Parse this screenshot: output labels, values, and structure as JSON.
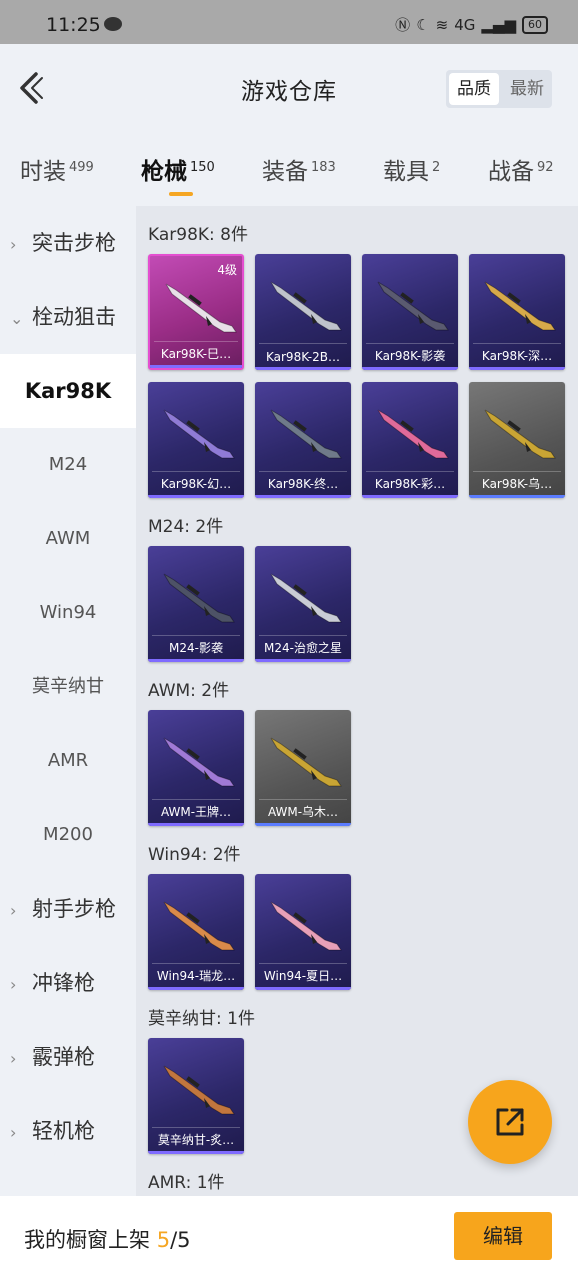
{
  "status_bar": {
    "time": "11:25",
    "network": "4G",
    "battery": "60"
  },
  "header": {
    "title": "游戏仓库",
    "sort_options": [
      "品质",
      "最新"
    ],
    "sort_active": "品质"
  },
  "category_tabs": [
    {
      "label": "时装",
      "count": "499"
    },
    {
      "label": "枪械",
      "count": "150",
      "active": true
    },
    {
      "label": "装备",
      "count": "183"
    },
    {
      "label": "载具",
      "count": "2"
    },
    {
      "label": "战备",
      "count": "92"
    }
  ],
  "sidebar": [
    {
      "label": "突击步枪",
      "type": "group",
      "expanded": false
    },
    {
      "label": "栓动狙击",
      "type": "group",
      "expanded": true
    },
    {
      "label": "Kar98K",
      "type": "sub",
      "selected": true
    },
    {
      "label": "M24",
      "type": "sub"
    },
    {
      "label": "AWM",
      "type": "sub"
    },
    {
      "label": "Win94",
      "type": "sub"
    },
    {
      "label": "莫辛纳甘",
      "type": "sub"
    },
    {
      "label": "AMR",
      "type": "sub"
    },
    {
      "label": "M200",
      "type": "sub"
    },
    {
      "label": "射手步枪",
      "type": "group",
      "expanded": false
    },
    {
      "label": "冲锋枪",
      "type": "group",
      "expanded": false
    },
    {
      "label": "霰弹枪",
      "type": "group",
      "expanded": false
    },
    {
      "label": "轻机枪",
      "type": "group",
      "expanded": false
    }
  ],
  "sections": [
    {
      "title": "Kar98K: 8件",
      "items": [
        {
          "name": "Kar98K-巳…",
          "style": "pink",
          "level": "4级",
          "gun_color": "#e8e0e8"
        },
        {
          "name": "Kar98K-2B…",
          "style": "purple",
          "gun_color": "#bfc3cc"
        },
        {
          "name": "Kar98K-影袭",
          "style": "purple",
          "gun_color": "#5a5a70"
        },
        {
          "name": "Kar98K-深…",
          "style": "purple",
          "gun_color": "#d6a94a"
        },
        {
          "name": "Kar98K-幻…",
          "style": "purple",
          "gun_color": "#8f7bd6"
        },
        {
          "name": "Kar98K-终…",
          "style": "purple",
          "gun_color": "#6f7a8a"
        },
        {
          "name": "Kar98K-彩…",
          "style": "purple",
          "gun_color": "#e06a9a"
        },
        {
          "name": "Kar98K-乌…",
          "style": "gray",
          "gun_color": "#c9a534"
        }
      ]
    },
    {
      "title": "M24: 2件",
      "items": [
        {
          "name": "M24-影袭",
          "style": "purple",
          "gun_color": "#4d5266"
        },
        {
          "name": "M24-治愈之星",
          "style": "purple",
          "gun_color": "#c9ccd6"
        }
      ]
    },
    {
      "title": "AWM: 2件",
      "items": [
        {
          "name": "AWM-王牌…",
          "style": "purple",
          "gun_color": "#a07ad6"
        },
        {
          "name": "AWM-乌木…",
          "style": "gray",
          "gun_color": "#c9a534"
        }
      ]
    },
    {
      "title": "Win94: 2件",
      "items": [
        {
          "name": "Win94-瑞龙…",
          "style": "purple",
          "gun_color": "#d98a4a"
        },
        {
          "name": "Win94-夏日…",
          "style": "purple",
          "gun_color": "#e8a0b8"
        }
      ]
    },
    {
      "title": "莫辛纳甘: 1件",
      "items": [
        {
          "name": "莫辛纳甘-炙…",
          "style": "purple",
          "gun_color": "#c2763e"
        }
      ]
    },
    {
      "title": "AMR: 1件",
      "items": []
    }
  ],
  "footer": {
    "label": "我的橱窗上架",
    "current": "5",
    "total": "/5",
    "edit_label": "编辑"
  }
}
